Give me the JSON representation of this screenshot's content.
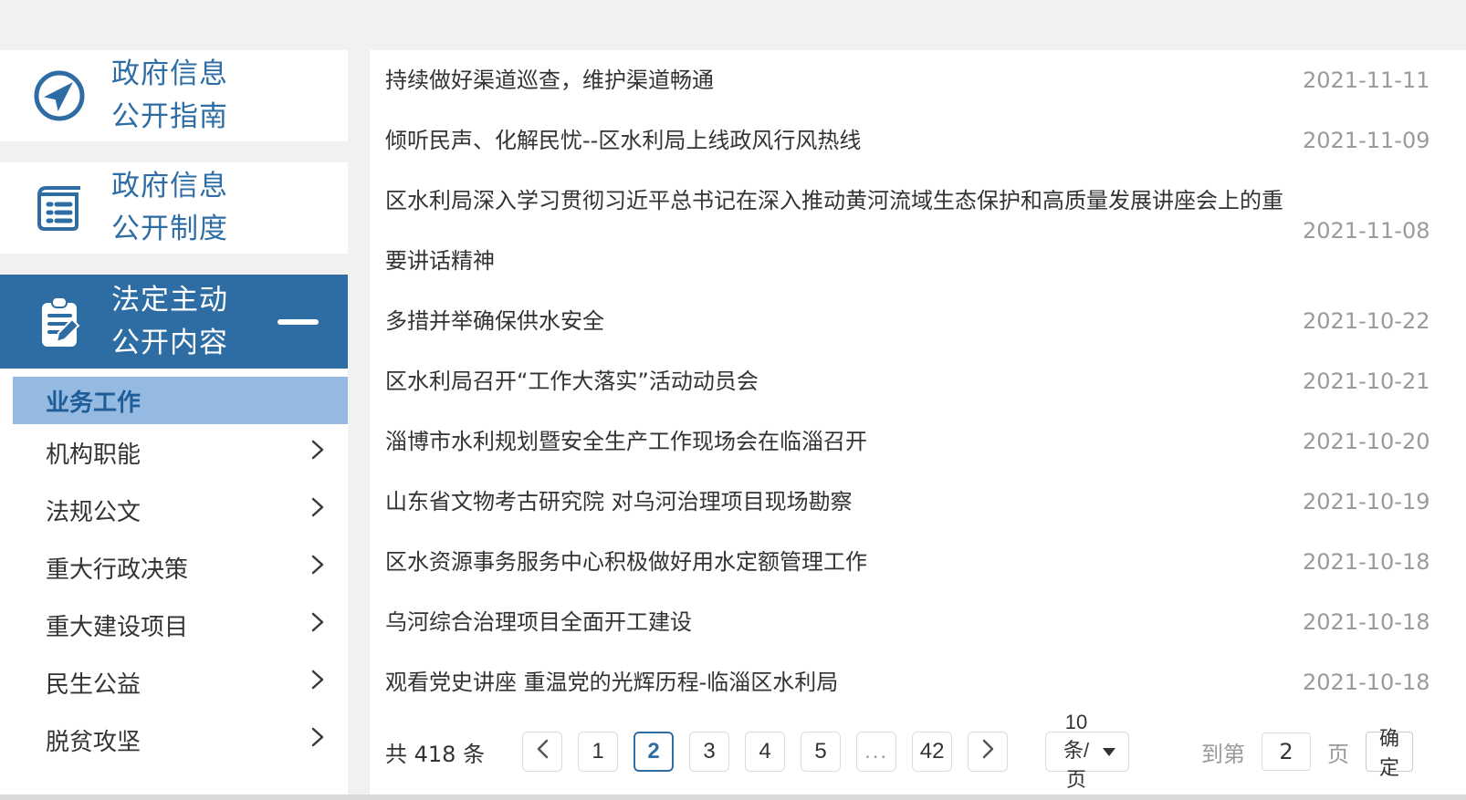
{
  "colors": {
    "accent": "#2e6da4",
    "submenu_active_bg": "#94bae2",
    "submenu_active_text": "#1d5c97",
    "page_bg": "#f1f1f1",
    "title_text": "#333333",
    "date_text": "#9a9a9a",
    "pagination_border": "#dcdcdc"
  },
  "icons": {
    "sidebar_cards": [
      "compass-icon",
      "book-list-icon",
      "clipboard-pencil-icon"
    ],
    "submenu_arrow": "chevron-right-icon",
    "pagination": [
      "chevron-left-icon",
      "chevron-right-icon",
      "caret-down-icon"
    ]
  },
  "sidebar": {
    "cards": [
      {
        "lines": [
          "政府信息",
          "公开指南"
        ]
      },
      {
        "lines": [
          "政府信息",
          "公开制度"
        ]
      },
      {
        "lines": [
          "法定主动",
          "公开内容"
        ],
        "expanded": true
      }
    ],
    "submenu": {
      "active_item": "业务工作",
      "items": [
        {
          "label": "机构职能"
        },
        {
          "label": "法规公文"
        },
        {
          "label": "重大行政决策"
        },
        {
          "label": "重大建设项目"
        },
        {
          "label": "民生公益"
        },
        {
          "label": "脱贫攻坚"
        }
      ]
    }
  },
  "news": {
    "items": [
      {
        "title": "持续做好渠道巡查，维护渠道畅通",
        "date": "2021-11-11"
      },
      {
        "title": "倾听民声、化解民忧--区水利局上线政风行风热线",
        "date": "2021-11-09"
      },
      {
        "title": "区水利局深入学习贯彻习近平总书记在深入推动黄河流域生态保护和高质量发展讲座会上的重要讲话精神",
        "date": "2021-11-08"
      },
      {
        "title": "多措并举确保供水安全",
        "date": "2021-10-22"
      },
      {
        "title": "区水利局召开“工作大落实”活动动员会",
        "date": "2021-10-21"
      },
      {
        "title": "淄博市水利规划暨安全生产工作现场会在临淄召开",
        "date": "2021-10-20"
      },
      {
        "title": "山东省文物考古研究院 对乌河治理项目现场勘察",
        "date": "2021-10-19"
      },
      {
        "title": "区水资源事务服务中心积极做好用水定额管理工作",
        "date": "2021-10-18"
      },
      {
        "title": "乌河综合治理项目全面开工建设",
        "date": "2021-10-18"
      },
      {
        "title": "观看党史讲座 重温党的光辉历程-临淄区水利局",
        "date": "2021-10-18"
      }
    ]
  },
  "pagination": {
    "total_label": "共 418 条",
    "pages": [
      "1",
      "2",
      "3",
      "4",
      "5",
      "...",
      "42"
    ],
    "active_page": "2",
    "page_size_label": "10 条/页",
    "jump_prefix": "到第",
    "jump_value": "2",
    "jump_suffix": "页",
    "confirm_label": "确定"
  }
}
